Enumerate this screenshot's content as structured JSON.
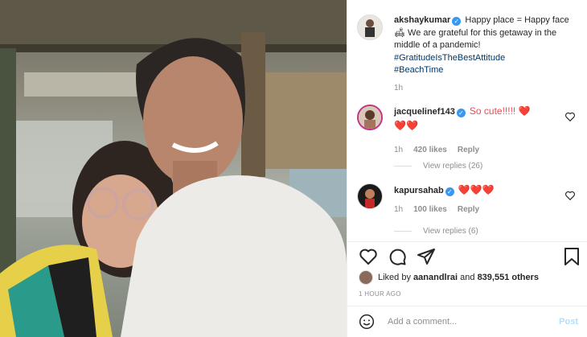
{
  "post": {
    "username": "akshaykumar",
    "caption_line1": "Happy place = Happy face 🛋 We are grateful for this getaway in the middle of a pandemic!",
    "hashtag1": "#GratitudeIsTheBestAttitude",
    "hashtag2": "#BeachTime",
    "age": "1h"
  },
  "comments": [
    {
      "username": "jacquelinef143",
      "text": "So cute!!!!! ❤️",
      "hearts_line2": "❤️❤️",
      "age": "1h",
      "likes": "420 likes",
      "reply": "Reply",
      "view_replies": "View replies (26)"
    },
    {
      "username": "kapursahab",
      "text": "❤️❤️❤️",
      "age": "1h",
      "likes": "100 likes",
      "reply": "Reply",
      "view_replies": "View replies (6)"
    }
  ],
  "likes": {
    "prefix": "Liked by",
    "user": "aanandlrai",
    "joiner": "and",
    "count": "839,551 others"
  },
  "time_ago": "1 HOUR AGO",
  "add_comment": {
    "placeholder": "Add a comment...",
    "post_label": "Post"
  },
  "icons": {
    "like": "heart-outline-icon",
    "comment": "comment-bubble-icon",
    "share": "paper-plane-icon",
    "save": "bookmark-icon",
    "emoji": "smiley-face-icon"
  },
  "colors": {
    "verified": "#3897f0",
    "hashtag": "#00376b",
    "heart": "#ed4956",
    "post_button_disabled": "#b2dffc",
    "meta_text": "#8e8e8e"
  }
}
